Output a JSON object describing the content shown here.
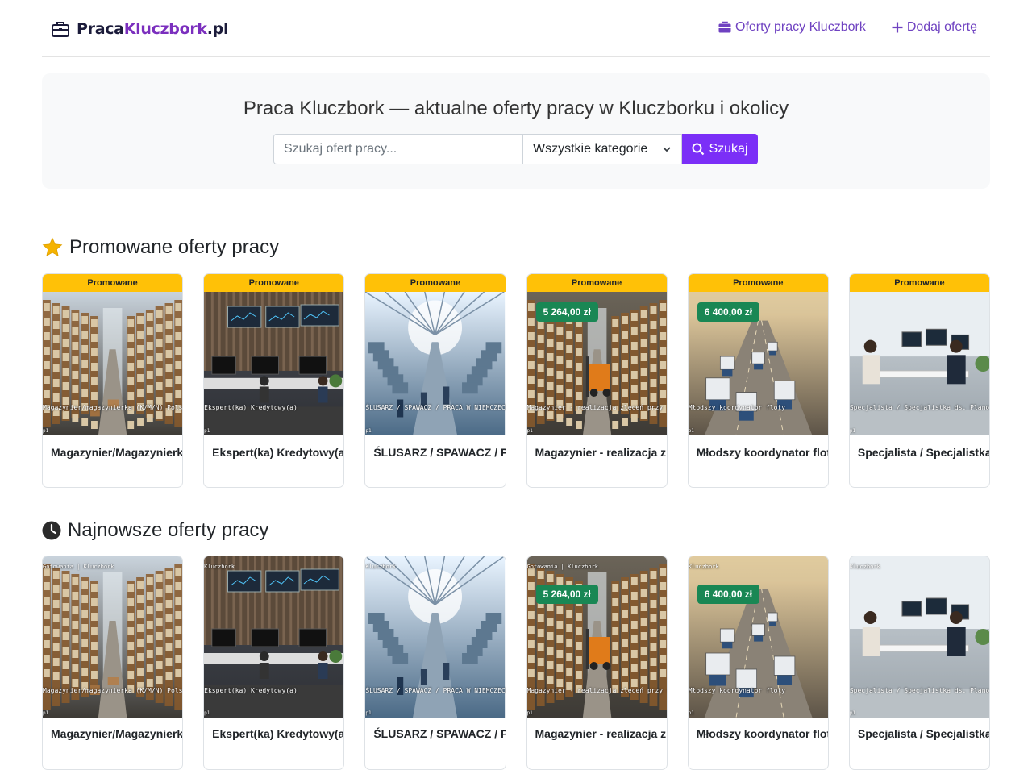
{
  "brand": {
    "part1": "Praca",
    "part2": "Kluczbork",
    "part3": ".pl",
    "icon": "briefcase-icon"
  },
  "nav": {
    "offers_label": "Oferty pracy Kluczbork",
    "add_label": "Dodaj ofertę"
  },
  "hero": {
    "title": "Praca Kluczbork — aktualne oferty pracy w Kluczborku i okolicy",
    "search_placeholder": "Szukaj ofert pracy...",
    "category_selected": "Wszystkie kategorie",
    "search_button": "Szukaj"
  },
  "colors": {
    "accent": "#7b2ff7",
    "link": "#6f42c1",
    "promo": "#ffc107",
    "salary": "#198754"
  },
  "promoted": {
    "title": "Promowane oferty pracy",
    "ribbon": "Promowane",
    "cards": [
      {
        "title": "Magazynier/Magazynierka (K/M/N)",
        "salary": "",
        "overlay": "Magazynier/magazynierka (K/M/N) Polskie Młyny",
        "footer": "p1",
        "scene": "warehouse"
      },
      {
        "title": "Ekspert(ka) Kredytowy(a)",
        "salary": "",
        "overlay": "Ekspert(ka) Kredytowy(a)",
        "footer": "p1",
        "scene": "office"
      },
      {
        "title": "ŚLUSARZ / SPAWACZ / PRACA W NIEMCZECH",
        "salary": "",
        "overlay": "ŚLUSARZ / SPAWACZ / PRACA W NIEMCZECH",
        "footer": "p1",
        "scene": "factory"
      },
      {
        "title": "Magazynier - realizacja zleceń",
        "salary": "5 264,00 zł",
        "overlay": "Magazynier - realizacja zleceń przy sortowaniu przesyłek",
        "footer": "p1",
        "scene": "forklift"
      },
      {
        "title": "Młodszy koordynator floty",
        "salary": "6 400,00 zł",
        "overlay": "Młodszy koordynator floty",
        "footer": "p1",
        "scene": "trucks"
      },
      {
        "title": "Specjalista / Specjalistka ds. Planowania Finansowego",
        "salary": "",
        "overlay": "Specjalista / Specjalistka ds. Planowania Finansowego",
        "footer": "p1",
        "scene": "meeting"
      }
    ]
  },
  "latest": {
    "title": "Najnowsze oferty pracy",
    "cards": [
      {
        "title": "Magazynier/Magazynierka (K/M/N)",
        "salary": "",
        "overlay": "Magazynier/magazynierka (K/M/N) Polskie Młyny",
        "top": "Gotowania  |  Kluczbork",
        "footer": "p1",
        "scene": "warehouse"
      },
      {
        "title": "Ekspert(ka) Kredytowy(a)",
        "salary": "",
        "overlay": "Ekspert(ka) Kredytowy(a)",
        "top": "Kluczbork",
        "footer": "p1",
        "scene": "office"
      },
      {
        "title": "ŚLUSARZ / SPAWACZ / PRACA W NIEMCZECH",
        "salary": "",
        "overlay": "ŚLUSARZ / SPAWACZ / PRACA W NIEMCZECH",
        "top": "Kluczbork",
        "footer": "p1",
        "scene": "factory"
      },
      {
        "title": "Magazynier - realizacja zleceń",
        "salary": "5 264,00 zł",
        "overlay": "Magazynier - realizacja zleceń przy sortowaniu przesyłek",
        "top": "Gotowania  |  Kluczbork",
        "footer": "p1",
        "scene": "forklift"
      },
      {
        "title": "Młodszy koordynator floty",
        "salary": "6 400,00 zł",
        "overlay": "Młodszy koordynator floty",
        "top": "Kluczbork",
        "footer": "p1",
        "scene": "trucks"
      },
      {
        "title": "Specjalista / Specjalistka ds. Planowania Finansowego",
        "salary": "",
        "overlay": "Specjalista / Specjalistka ds. Planowania Finansowego",
        "top": "Kluczbork",
        "footer": "p1",
        "scene": "meeting"
      }
    ]
  }
}
